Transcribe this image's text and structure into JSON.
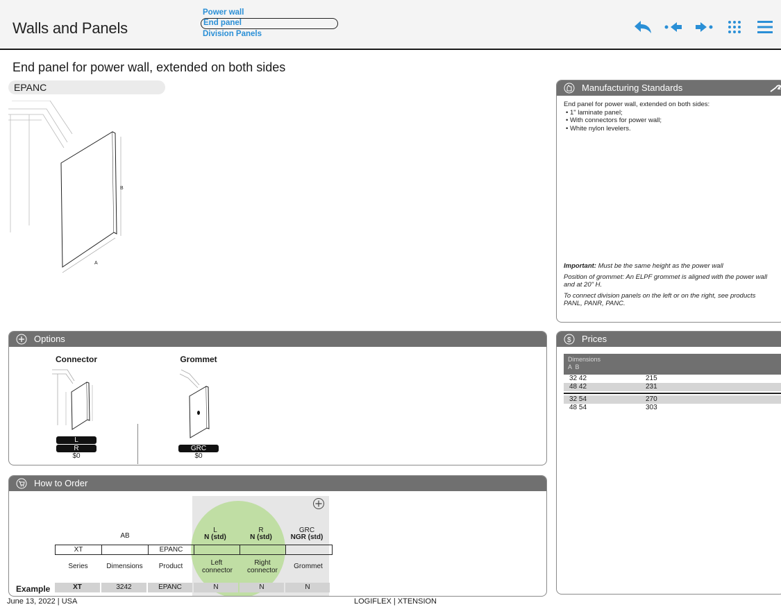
{
  "header": {
    "title": "Walls and Panels",
    "nav": [
      "Power wall",
      "End panel",
      "Division Panels"
    ],
    "active_nav": "End panel",
    "icons": [
      "back-arrow-icon",
      "previous-icon",
      "next-icon",
      "grid-icon",
      "menu-icon"
    ],
    "accent": "#2a8fd6"
  },
  "product": {
    "subtitle": "End panel for power wall, extended on both sides",
    "code": "EPANC",
    "dim_a": "A",
    "dim_b": "B"
  },
  "manufacturing": {
    "title": "Manufacturing Standards",
    "intro": "End panel for power wall, extended on both sides:",
    "bullets": [
      "1\" laminate panel;",
      "With connectors for power wall;",
      "White nylon levelers."
    ],
    "important_label": "Important:",
    "important_text": " Must be the same height as the power wall",
    "note1": "Position of grommet: An ELPF grommet is aligned with the power wall and at 20\" H.",
    "note2": "To connect division panels on the left or on the right, see products PANL, PANR, PANC."
  },
  "options": {
    "title": "Options",
    "connector": {
      "title": "Connector",
      "tags": [
        "L",
        "R"
      ],
      "price": "$0"
    },
    "grommet": {
      "title": "Grommet",
      "tags": [
        "GRC"
      ],
      "price": "$0"
    }
  },
  "prices": {
    "title": "Prices",
    "head_label": "Dimensions",
    "head_cols": "A  B",
    "group1": [
      {
        "dim": "32 42",
        "price": "215"
      },
      {
        "dim": "48 42",
        "price": "231"
      }
    ],
    "group2": [
      {
        "dim": "32 54",
        "price": "270"
      },
      {
        "dim": "48 54",
        "price": "303"
      }
    ]
  },
  "order": {
    "title": "How to Order",
    "head_ab": "AB",
    "head_l": "L",
    "head_l_std": "N (std)",
    "head_r": "R",
    "head_r_std": "N (std)",
    "head_grc": "GRC",
    "head_grc_std": "NGR (std)",
    "boxes": [
      "XT",
      "",
      "EPANC",
      "",
      "",
      ""
    ],
    "labels": [
      "Series",
      "Dimensions",
      "Product",
      "Left connector",
      "Right connector",
      "Grommet"
    ],
    "example_label": "Example",
    "example": [
      "XT",
      "3242",
      "EPANC",
      "N",
      "N",
      "N"
    ]
  },
  "footer": {
    "date": "June 13, 2022 | USA",
    "brand": "LOGIFLEX | XTENSION"
  }
}
